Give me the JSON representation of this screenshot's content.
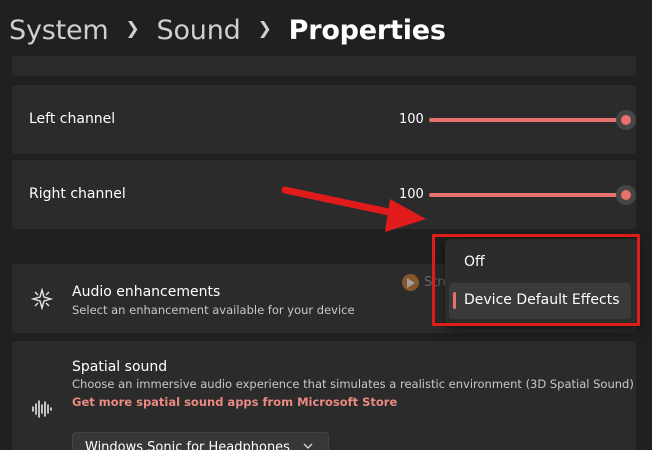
{
  "breadcrumb": {
    "items": [
      "System",
      "Sound",
      "Properties"
    ]
  },
  "left_channel": {
    "label": "Left channel",
    "value": "100",
    "level": 1.0
  },
  "right_channel": {
    "label": "Right channel",
    "value": "100",
    "level": 1.0
  },
  "audio_enhancements": {
    "title": "Audio enhancements",
    "description": "Select an enhancement available for your device",
    "icon": "audio-enhancements-icon"
  },
  "enhancement_menu": {
    "options": [
      "Off",
      "Device Default Effects"
    ],
    "selected": "Device Default Effects"
  },
  "spatial_sound": {
    "title": "Spatial sound",
    "description": "Choose an immersive audio experience that simulates a realistic environment (3D Spatial Sound)",
    "link": "Get more spatial sound apps from Microsoft Store",
    "icon": "spatial-sound-icon",
    "dropdown_value": "Windows Sonic for Headphones"
  },
  "watermark": {
    "text": "StreamFox"
  },
  "colors": {
    "accent": "#e8716d",
    "annotation_red": "#dd1c1c",
    "background": "#202020",
    "card": "#2b2b2b"
  }
}
